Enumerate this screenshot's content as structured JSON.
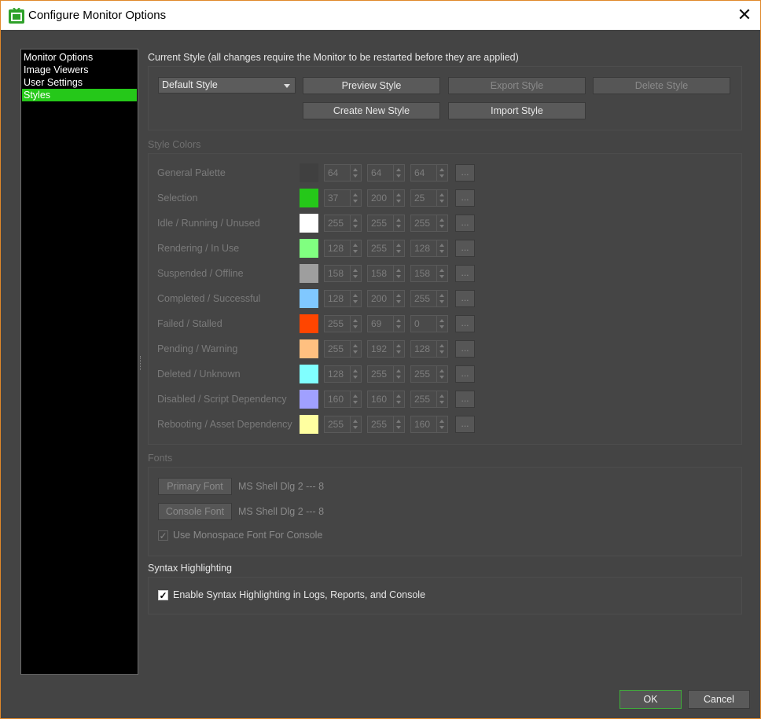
{
  "window": {
    "title": "Configure Monitor Options",
    "close_glyph": "✕"
  },
  "nav": {
    "items": [
      "Monitor Options",
      "Image Viewers",
      "User Settings",
      "Styles"
    ],
    "selected": "Styles"
  },
  "current_style": {
    "heading": "Current Style (all changes require the Monitor to be restarted before they are applied)",
    "selected_style": "Default Style",
    "buttons": {
      "preview": "Preview Style",
      "export": "Export Style",
      "delete": "Delete Style",
      "create": "Create New Style",
      "import": "Import Style"
    }
  },
  "style_colors": {
    "heading": "Style Colors",
    "more_label": "...",
    "rows": [
      {
        "label": "General Palette",
        "color": "#404040",
        "r": "64",
        "g": "64",
        "b": "64"
      },
      {
        "label": "Selection",
        "color": "#25c819",
        "r": "37",
        "g": "200",
        "b": "25"
      },
      {
        "label": "Idle / Running / Unused",
        "color": "#ffffff",
        "r": "255",
        "g": "255",
        "b": "255"
      },
      {
        "label": "Rendering / In Use",
        "color": "#80ff80",
        "r": "128",
        "g": "255",
        "b": "128"
      },
      {
        "label": "Suspended / Offline",
        "color": "#9e9e9e",
        "r": "158",
        "g": "158",
        "b": "158"
      },
      {
        "label": "Completed / Successful",
        "color": "#80c8ff",
        "r": "128",
        "g": "200",
        "b": "255"
      },
      {
        "label": "Failed / Stalled",
        "color": "#ff4500",
        "r": "255",
        "g": "69",
        "b": "0"
      },
      {
        "label": "Pending / Warning",
        "color": "#ffc080",
        "r": "255",
        "g": "192",
        "b": "128"
      },
      {
        "label": "Deleted / Unknown",
        "color": "#80ffff",
        "r": "128",
        "g": "255",
        "b": "255"
      },
      {
        "label": "Disabled / Script Dependency",
        "color": "#a0a0ff",
        "r": "160",
        "g": "160",
        "b": "255"
      },
      {
        "label": "Rebooting / Asset Dependency",
        "color": "#ffffa0",
        "r": "255",
        "g": "255",
        "b": "160"
      }
    ]
  },
  "fonts": {
    "heading": "Fonts",
    "primary_button": "Primary Font",
    "primary_value": "MS Shell Dlg 2 --- 8",
    "console_button": "Console Font",
    "console_value": "MS Shell Dlg 2 --- 8",
    "monospace_label": "Use Monospace Font For Console",
    "monospace_checked": true
  },
  "syntax": {
    "heading": "Syntax Highlighting",
    "enable_label": "Enable Syntax Highlighting in Logs, Reports, and Console",
    "enable_checked": true
  },
  "footer": {
    "ok": "OK",
    "cancel": "Cancel"
  },
  "check_glyph": "✓"
}
